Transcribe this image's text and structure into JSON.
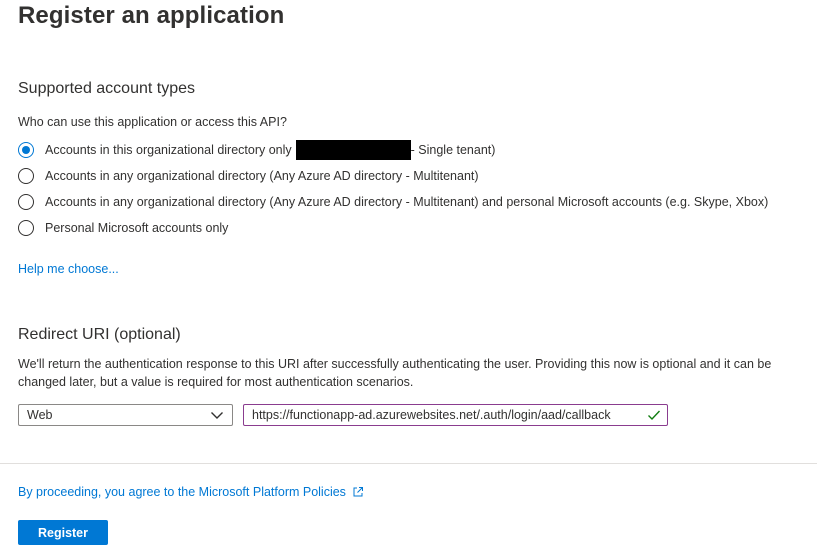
{
  "page": {
    "title": "Register an application"
  },
  "account_types": {
    "section_title": "Supported account types",
    "question": "Who can use this application or access this API?",
    "options": [
      {
        "label_before": "Accounts in this organizational directory only",
        "label_after": "- Single tenant)",
        "checked": true,
        "redacted": true
      },
      {
        "label": "Accounts in any organizational directory (Any Azure AD directory - Multitenant)",
        "checked": false
      },
      {
        "label": "Accounts in any organizational directory (Any Azure AD directory - Multitenant) and personal Microsoft accounts (e.g. Skype, Xbox)",
        "checked": false
      },
      {
        "label": "Personal Microsoft accounts only",
        "checked": false
      }
    ],
    "help_link": "Help me choose..."
  },
  "redirect": {
    "section_title": "Redirect URI (optional)",
    "description": "We'll return the authentication response to this URI after successfully authenticating the user. Providing this now is optional and it can be changed later, but a value is required for most authentication scenarios.",
    "platform": "Web",
    "uri_value": "https://functionapp-ad.azurewebsites.net/.auth/login/aad/callback"
  },
  "footer": {
    "policy_link": "By proceeding, you agree to the Microsoft Platform Policies",
    "register_label": "Register"
  },
  "colors": {
    "accent": "#0078d4",
    "valid": "#107c10",
    "input_border_focus": "#8a3c8f"
  },
  "icons": {
    "select_chevron": "chevron-down-icon",
    "valid": "checkmark-icon",
    "external": "external-link-icon"
  }
}
